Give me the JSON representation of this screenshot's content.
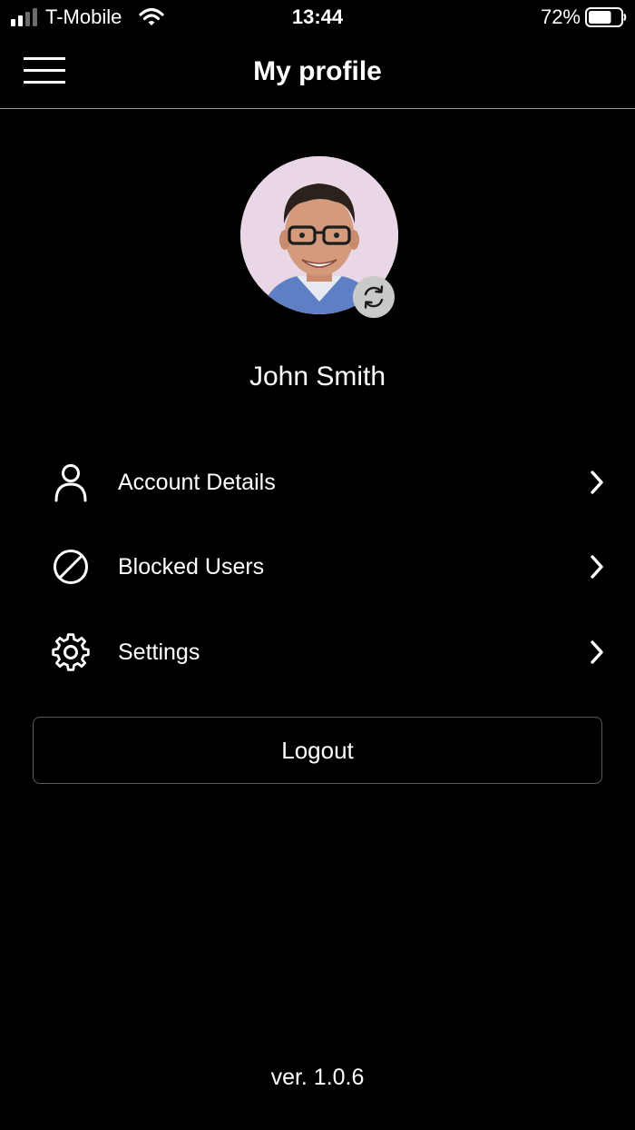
{
  "status_bar": {
    "carrier": "T-Mobile",
    "time": "13:44",
    "battery_percent": "72%",
    "battery_level": 0.72,
    "signal_bars": 2
  },
  "header": {
    "title": "My profile",
    "menu_icon": "hamburger-menu-icon"
  },
  "profile": {
    "name": "John Smith",
    "change_photo_icon": "refresh-icon"
  },
  "menu": {
    "items": [
      {
        "label": "Account Details",
        "icon": "user-icon"
      },
      {
        "label": "Blocked Users",
        "icon": "blocked-icon"
      },
      {
        "label": "Settings",
        "icon": "gear-icon"
      }
    ]
  },
  "logout": {
    "label": "Logout"
  },
  "footer": {
    "version": "ver. 1.0.6"
  },
  "colors": {
    "background": "#000000",
    "text": "#ffffff",
    "divider": "#9a9a9a",
    "button_border": "#5a5a5a"
  }
}
